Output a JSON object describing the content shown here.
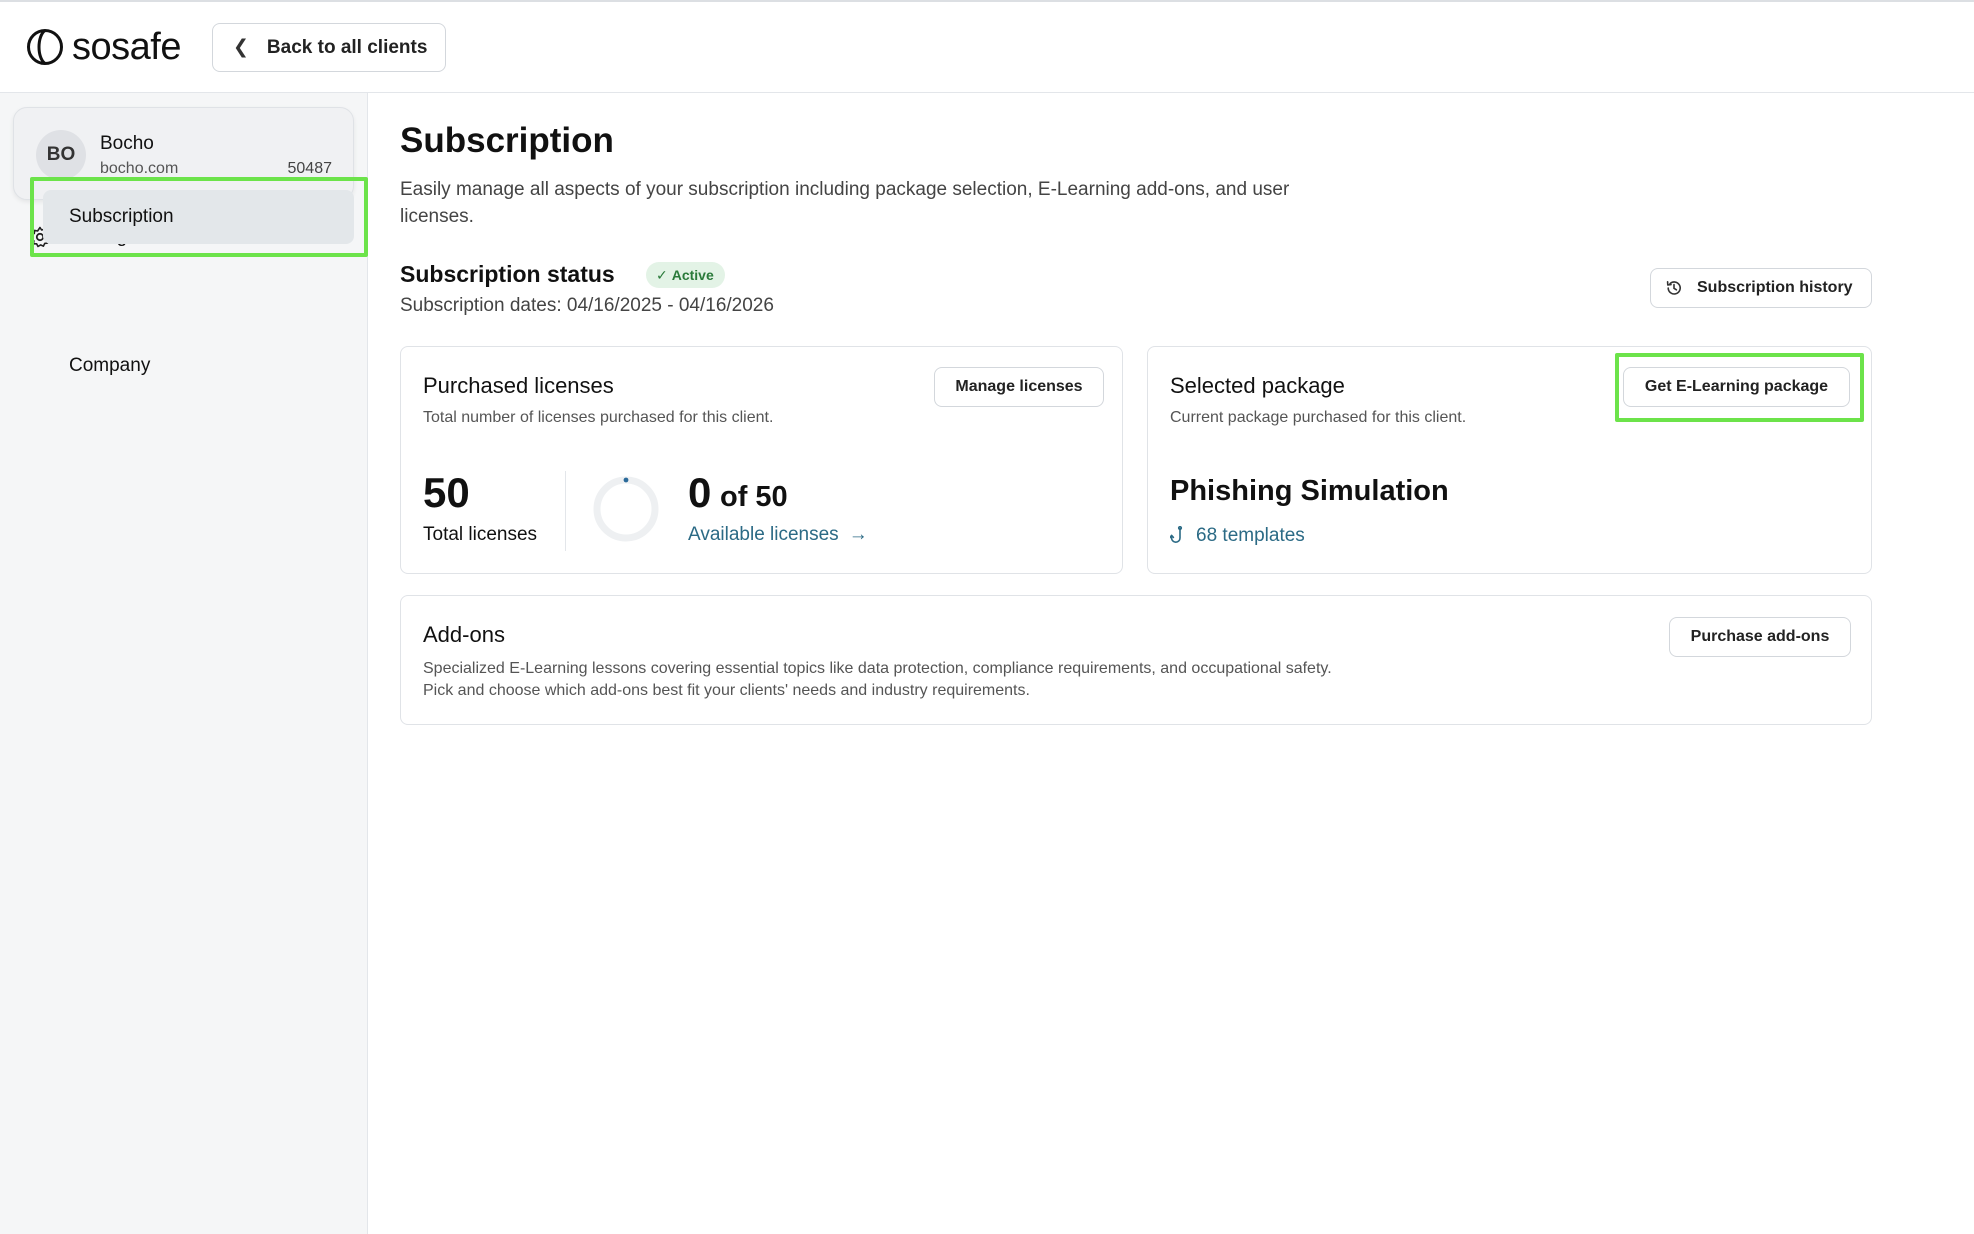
{
  "header": {
    "logo_text": "sosafe",
    "back_button": "Back to all clients"
  },
  "sidebar": {
    "client": {
      "initials": "BO",
      "name": "Bocho",
      "domain": "bocho.com",
      "id": "50487"
    },
    "settings_label": "Settings",
    "items": [
      {
        "label": "Subscription",
        "active": true
      },
      {
        "label": "Company",
        "active": false
      }
    ]
  },
  "main": {
    "title": "Subscription",
    "description": "Easily manage all aspects of your subscription including package selection, E-Learning add-ons, and user licenses.",
    "status": {
      "title": "Subscription status",
      "badge": "Active",
      "dates": "Subscription dates: 04/16/2025 - 04/16/2026",
      "history_button": "Subscription history"
    },
    "licenses": {
      "title": "Purchased licenses",
      "subtitle": "Total number of licenses purchased for this client.",
      "button": "Manage licenses",
      "total": "50",
      "total_label": "Total licenses",
      "available": "0",
      "available_of": "of 50",
      "available_link": "Available licenses",
      "available_fraction": 0.0
    },
    "package": {
      "title": "Selected package",
      "subtitle": "Current package purchased for this client.",
      "button": "Get E-Learning package",
      "name": "Phishing Simulation",
      "templates": "68 templates"
    },
    "addons": {
      "title": "Add-ons",
      "description_line1": "Specialized E-Learning lessons covering essential topics like data protection, compliance requirements, and occupational safety.",
      "description_line2": "Pick and choose which add-ons best fit your clients' needs and industry requirements.",
      "button": "Purchase add-ons"
    }
  },
  "colors": {
    "highlight": "#6ce34a",
    "link": "#2b6a85",
    "active_badge_bg": "#e3f3e6",
    "active_badge_text": "#2a7a3a"
  },
  "icons": [
    "sosafe-logo-icon",
    "chevron-left-icon",
    "gear-icon",
    "history-icon",
    "check-icon",
    "arrow-right-icon",
    "hook-icon"
  ]
}
